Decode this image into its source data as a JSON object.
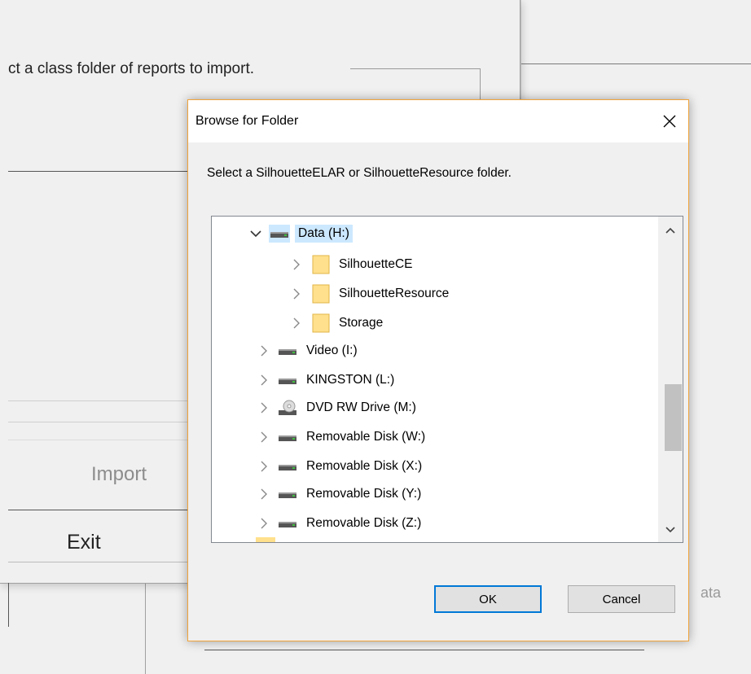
{
  "background": {
    "instruction_text": "ct a class folder of reports to import.",
    "import_button_label": "Import",
    "exit_button_label": "Exit",
    "partial_button_text": "ata"
  },
  "dialog": {
    "title": "Browse for Folder",
    "close_icon": "close-icon",
    "prompt": "Select a SilhouetteELAR or SilhouetteResource folder.",
    "tree": [
      {
        "label": "Data (H:)",
        "icon": "drive-icon",
        "expanded": true,
        "selected": true
      },
      {
        "label": "SilhouetteCE",
        "icon": "folder-icon"
      },
      {
        "label": "SilhouetteResource",
        "icon": "folder-icon"
      },
      {
        "label": "Storage",
        "icon": "folder-icon"
      },
      {
        "label": "Video (I:)",
        "icon": "drive-icon"
      },
      {
        "label": "KINGSTON (L:)",
        "icon": "drive-icon"
      },
      {
        "label": "DVD RW Drive (M:)",
        "icon": "dvd-drive-icon"
      },
      {
        "label": "Removable Disk (W:)",
        "icon": "drive-icon"
      },
      {
        "label": "Removable Disk (X:)",
        "icon": "drive-icon"
      },
      {
        "label": "Removable Disk (Y:)",
        "icon": "drive-icon"
      },
      {
        "label": "Removable Disk (Z:)",
        "icon": "drive-icon"
      }
    ],
    "ok_label": "OK",
    "cancel_label": "Cancel"
  },
  "colors": {
    "dialog_border": "#f0a33a",
    "selection": "#cce8ff",
    "default_button_border": "#0078d7"
  }
}
